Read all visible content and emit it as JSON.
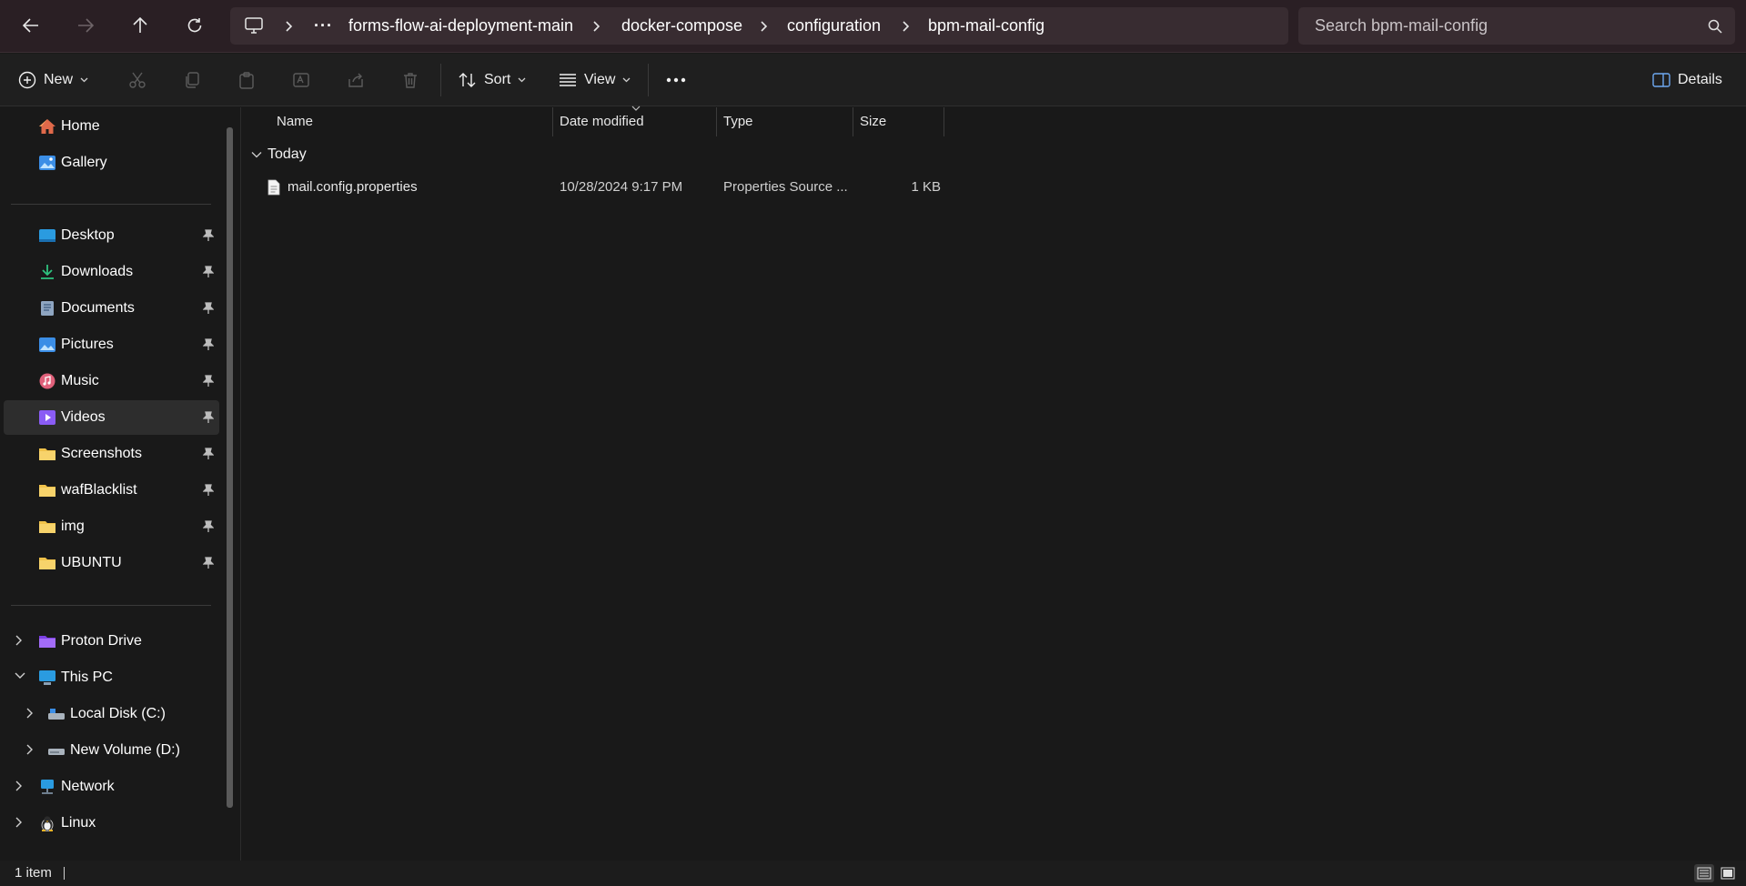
{
  "window": {
    "address": {
      "segments": [
        "forms-flow-ai-deployment-main",
        "docker-compose",
        "configuration",
        "bpm-mail-config"
      ],
      "overflow": "···"
    },
    "search": {
      "placeholder": "Search bpm-mail-config"
    }
  },
  "toolbar": {
    "new_label": "New",
    "sort_label": "Sort",
    "view_label": "View",
    "details_label": "Details"
  },
  "sidebar": {
    "top_items": [
      {
        "label": "Home",
        "icon": "home-icon"
      },
      {
        "label": "Gallery",
        "icon": "gallery-icon"
      }
    ],
    "pinned_items": [
      {
        "label": "Desktop",
        "icon": "desktop-folder-icon"
      },
      {
        "label": "Downloads",
        "icon": "downloads-icon"
      },
      {
        "label": "Documents",
        "icon": "documents-icon"
      },
      {
        "label": "Pictures",
        "icon": "pictures-icon"
      },
      {
        "label": "Music",
        "icon": "music-icon"
      },
      {
        "label": "Videos",
        "icon": "videos-icon",
        "selected": true
      },
      {
        "label": "Screenshots",
        "icon": "folder-icon"
      },
      {
        "label": "wafBlacklist",
        "icon": "folder-icon"
      },
      {
        "label": "img",
        "icon": "folder-icon"
      },
      {
        "label": "UBUNTU",
        "icon": "folder-icon"
      }
    ],
    "tree_items": [
      {
        "label": "Proton Drive",
        "icon": "proton-drive-icon",
        "expanded": false
      },
      {
        "label": "This PC",
        "icon": "this-pc-icon",
        "expanded": true
      },
      {
        "label": "Local Disk (C:)",
        "icon": "drive-icon",
        "expanded": false
      },
      {
        "label": "New Volume (D:)",
        "icon": "drive-icon",
        "expanded": false
      },
      {
        "label": "Network",
        "icon": "network-icon",
        "expanded": false
      },
      {
        "label": "Linux",
        "icon": "linux-icon",
        "expanded": false
      }
    ]
  },
  "file_list": {
    "columns": [
      "Name",
      "Date modified",
      "Type",
      "Size"
    ],
    "group": "Today",
    "rows": [
      {
        "name": "mail.config.properties",
        "date": "10/28/2024 9:17 PM",
        "type": "Properties Source ...",
        "size": "1 KB"
      }
    ]
  },
  "status": {
    "item_count": "1 item"
  },
  "colors": {
    "titlebar": "#2a1f24",
    "address_bg": "#382c31",
    "background": "#191919",
    "folder_yellow": "#f0c24a"
  }
}
